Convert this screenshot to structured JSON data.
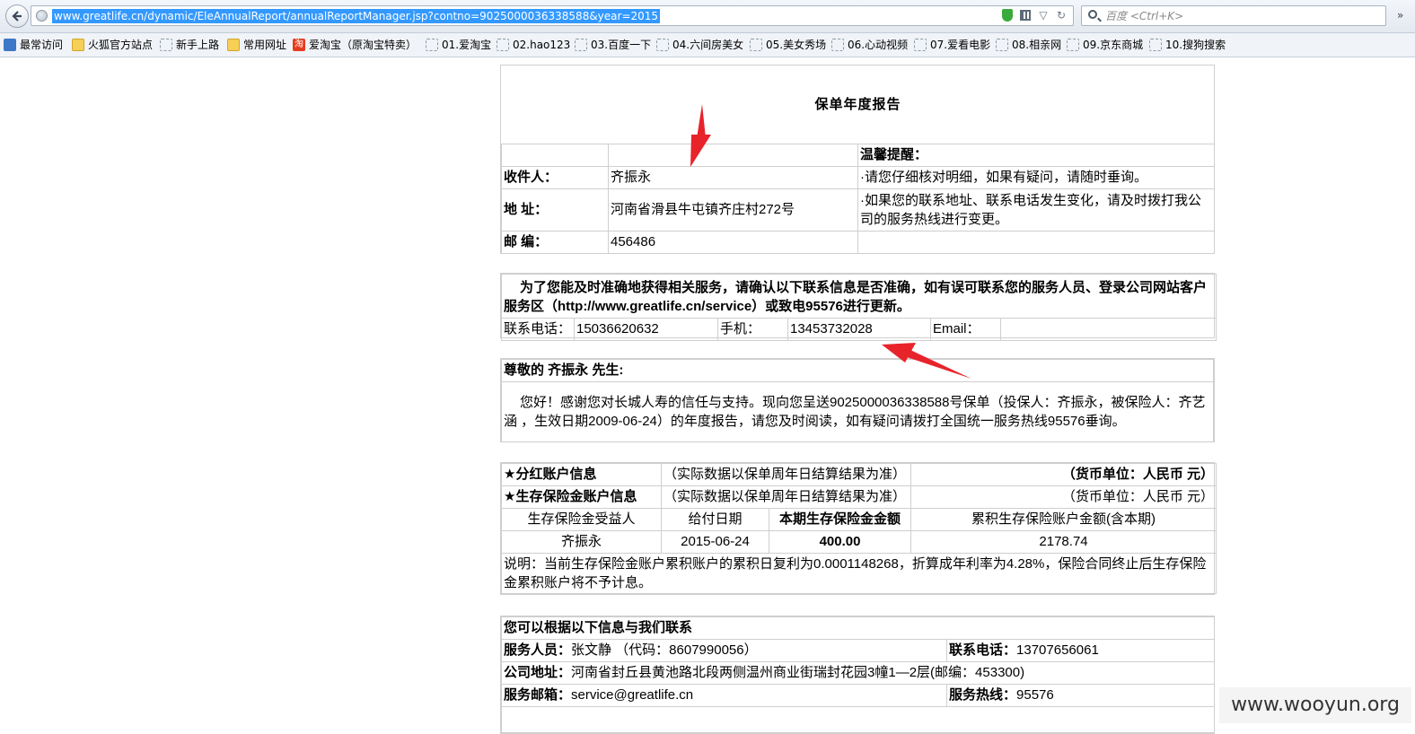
{
  "browser": {
    "url": "www.greatlife.cn/dynamic/EleAnnualReport/annualReportManager.jsp?contno=9025000036338588&year=2015",
    "search_placeholder": "百度 <Ctrl+K>",
    "bookmarks": [
      {
        "label": "最常访问",
        "icon": "most-visited-icon"
      },
      {
        "label": "火狐官方站点",
        "icon": "firefox-icon"
      },
      {
        "label": "新手上路",
        "icon": "page-icon"
      },
      {
        "label": "常用网址",
        "icon": "folder-icon"
      },
      {
        "label": "爱淘宝（原淘宝特卖）",
        "icon": "taobao-icon"
      },
      {
        "label": "01.爱淘宝",
        "icon": "page-icon"
      },
      {
        "label": "02.hao123",
        "icon": "page-icon"
      },
      {
        "label": "03.百度一下",
        "icon": "page-icon"
      },
      {
        "label": "04.六间房美女",
        "icon": "page-icon"
      },
      {
        "label": "05.美女秀场",
        "icon": "page-icon"
      },
      {
        "label": "06.心动视频",
        "icon": "page-icon"
      },
      {
        "label": "07.爱看电影",
        "icon": "page-icon"
      },
      {
        "label": "08.相亲网",
        "icon": "page-icon"
      },
      {
        "label": "09.京东商城",
        "icon": "page-icon"
      },
      {
        "label": "10.搜狗搜索",
        "icon": "page-icon"
      }
    ]
  },
  "report": {
    "title": "保单年度报告",
    "reminder_title": "温馨提醒：",
    "reminder_1": "·请您仔细核对明细，如果有疑问，请随时垂询。",
    "reminder_2": "·如果您的联系地址、联系电话发生变化，请及时拨打我公司的服务热线进行变更。",
    "recipient_label": "收件人：",
    "recipient_value": "齐振永",
    "address_label": "地 址：",
    "address_value": "河南省滑县牛屯镇齐庄村272号",
    "zip_label": "邮 编：",
    "zip_value": "456486"
  },
  "contact_check": {
    "notice": "为了您能及时准确地获得相关服务，请确认以下联系信息是否准确，如有误可联系您的服务人员、登录公司网站客户服务区（http://www.greatlife.cn/service）或致电95576进行更新。",
    "phone_label": "联系电话：",
    "phone_value": "15036620632",
    "mobile_label": "手机：",
    "mobile_value": "13453732028",
    "email_label": "Email：",
    "email_value": ""
  },
  "greeting": {
    "salutation": "尊敬的 齐振永 先生:",
    "body": "您好！感谢您对长城人寿的信任与支持。现向您呈送9025000036338588号保单（投保人：齐振永，被保险人：齐艺涵 ，生效日期2009-06-24）的年度报告，请您及时阅读，如有疑问请拨打全国统一服务热线95576垂询。"
  },
  "accounts": {
    "dividend_title": "★分红账户信息",
    "dividend_note": "（实际数据以保单周年日结算结果为准）",
    "dividend_currency": "（货币单位：人民币 元）",
    "survival_title": "★生存保险金账户信息",
    "survival_note": "（实际数据以保单周年日结算结果为准）",
    "survival_currency": "（货币单位：人民币 元）",
    "headers": [
      "生存保险金受益人",
      "给付日期",
      "本期生存保险金金额",
      "累积生存保险账户金额(含本期)"
    ],
    "row": [
      "齐振永",
      "2015-06-24",
      "400.00",
      "2178.74"
    ],
    "explanation": "说明：当前生存保险金账户累积账户的累积日复利为0.0001148268，折算成年利率为4.28%，保险合同终止后生存保险金累积账户将不予计息。"
  },
  "service": {
    "title": "您可以根据以下信息与我们联系",
    "agent_label": "服务人员：",
    "agent_value": "张文静 （代码：8607990056）",
    "agent_phone_label": "联系电话：",
    "agent_phone_value": "13707656061",
    "company_address_label": "公司地址：",
    "company_address_value": "河南省封丘县黄池路北段两侧温州商业街瑞封花园3幢1—2层(邮编：453300)",
    "email_label": "服务邮箱：",
    "email_value": "service@greatlife.cn",
    "hotline_label": "服务热线：",
    "hotline_value": "95576"
  },
  "watermark": "www.wooyun.org",
  "colors": {
    "url_highlight": "#3399ff",
    "arrow": "#e8232a",
    "table_border": "#cfcfcf"
  }
}
